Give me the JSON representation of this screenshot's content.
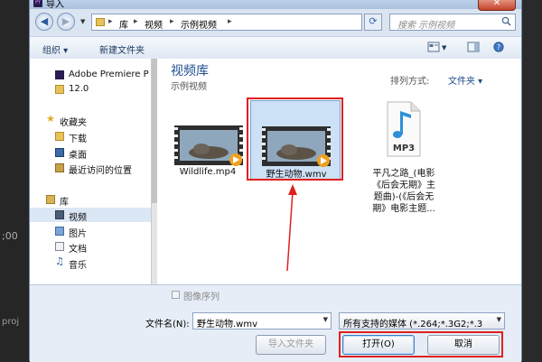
{
  "window": {
    "title": "导入",
    "app_icon_text": "Pr",
    "close_glyph": "✕"
  },
  "background": {
    "left_timecode": ";00",
    "left_label": "proj"
  },
  "address_bar": {
    "back_glyph": "◀",
    "forward_glyph": "▶",
    "crumbs": [
      "库",
      "视频",
      "示例视频"
    ],
    "separator": "▸",
    "refresh_glyph": "⟳"
  },
  "search": {
    "placeholder": "搜索 示例视频"
  },
  "toolbar": {
    "organize_label": "组织 ▾",
    "new_folder_label": "新建文件夹"
  },
  "nav": {
    "items": [
      {
        "label": "Adobe Premiere P",
        "icon": "premiere-icon"
      },
      {
        "label": "12.0",
        "icon": "folder-icon"
      },
      {
        "label": "收藏夹",
        "icon": "star-icon"
      },
      {
        "label": "下载",
        "icon": "folder-icon"
      },
      {
        "label": "桌面",
        "icon": "desktop-icon"
      },
      {
        "label": "最近访问的位置",
        "icon": "recent-icon"
      },
      {
        "label": "库",
        "icon": "library-icon"
      },
      {
        "label": "视频",
        "icon": "video-icon"
      },
      {
        "label": "图片",
        "icon": "picture-icon"
      },
      {
        "label": "文档",
        "icon": "document-icon"
      },
      {
        "label": "音乐",
        "icon": "music-icon"
      }
    ],
    "selected_index": 7
  },
  "main": {
    "library_title": "视频库",
    "library_subtitle": "示例视频",
    "arrange_label": "排列方式:",
    "arrange_value": "文件夹 ▾",
    "files": [
      {
        "name": "Wildlife.mp4",
        "icon": "video-thumbnail-icon",
        "selected": false
      },
      {
        "name": "野生动物.wmv",
        "icon": "video-thumbnail-icon",
        "selected": true
      },
      {
        "name_lines": [
          "平凡之路_(电影",
          "《后会无期》主",
          "题曲)-(《后会无",
          "期》电影主题..."
        ],
        "icon": "mp3-file-icon",
        "badge": "MP3",
        "selected": false
      }
    ]
  },
  "bottom": {
    "image_sequence_label": "图像序列",
    "filename_label": "文件名(N):",
    "filename_value": "野生动物.wmv",
    "filetype_value": "所有支持的媒体 (*.264;*.3G2;*.3",
    "import_folder_label": "导入文件夹",
    "open_label": "打开(O)",
    "cancel_label": "取消"
  },
  "colors": {
    "annotation_red": "#e02020",
    "library_blue": "#1f4e8c"
  }
}
